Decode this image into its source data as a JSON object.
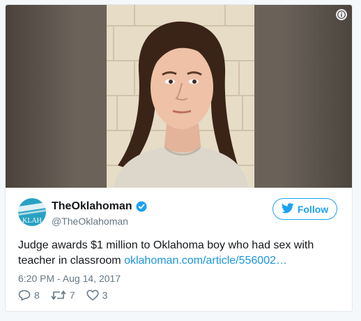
{
  "media": {
    "info_icon": "info-icon",
    "description_hidden": ""
  },
  "author": {
    "display_name": "TheOklahoman",
    "screen_name": "@TheOklahoman",
    "avatar_text": "KLAH",
    "verified_icon": "verified-badge-icon"
  },
  "follow_button": {
    "label": "Follow",
    "icon": "twitter-bird-icon"
  },
  "tweet": {
    "text": "Judge awards $1 million to Oklahoma boy who had sex with teacher in classroom",
    "link_text": "oklahoman.com/article/556002…",
    "timestamp": "6:20 PM - Aug 14, 2017"
  },
  "actions": {
    "reply_count": "8",
    "retweet_count": "7",
    "like_count": "3"
  },
  "colors": {
    "brand_blue": "#1da1f2",
    "link_blue": "#1b95e0",
    "muted_gray": "#657786"
  }
}
